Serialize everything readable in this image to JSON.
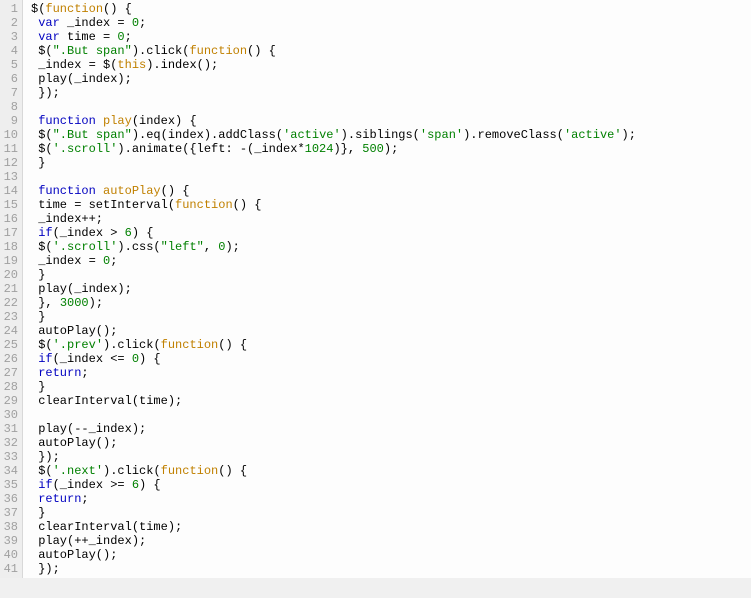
{
  "line_count": 41,
  "code_lines": [
    [
      [
        "punc",
        "$("
      ],
      [
        "fn",
        "function"
      ],
      [
        "punc",
        "() {"
      ]
    ],
    [
      [
        "punc",
        " "
      ],
      [
        "kw",
        "var"
      ],
      [
        "punc",
        " _index = "
      ],
      [
        "num",
        "0"
      ],
      [
        "punc",
        ";"
      ]
    ],
    [
      [
        "punc",
        " "
      ],
      [
        "kw",
        "var"
      ],
      [
        "punc",
        " time = "
      ],
      [
        "num",
        "0"
      ],
      [
        "punc",
        ";"
      ]
    ],
    [
      [
        "punc",
        " $("
      ],
      [
        "str",
        "\".But span\""
      ],
      [
        "punc",
        ").click("
      ],
      [
        "fn",
        "function"
      ],
      [
        "punc",
        "() {"
      ]
    ],
    [
      [
        "punc",
        " _index = $("
      ],
      [
        "this",
        "this"
      ],
      [
        "punc",
        ").index();"
      ]
    ],
    [
      [
        "punc",
        " play(_index);"
      ]
    ],
    [
      [
        "punc",
        " });"
      ]
    ],
    [
      [
        "punc",
        ""
      ]
    ],
    [
      [
        "punc",
        " "
      ],
      [
        "kw",
        "function"
      ],
      [
        "punc",
        " "
      ],
      [
        "fn",
        "play"
      ],
      [
        "punc",
        "(index) {"
      ]
    ],
    [
      [
        "punc",
        " $("
      ],
      [
        "str",
        "\".But span\""
      ],
      [
        "punc",
        ").eq(index).addClass("
      ],
      [
        "str",
        "'active'"
      ],
      [
        "punc",
        ").siblings("
      ],
      [
        "str",
        "'span'"
      ],
      [
        "punc",
        ").removeClass("
      ],
      [
        "str",
        "'active'"
      ],
      [
        "punc",
        ");"
      ]
    ],
    [
      [
        "punc",
        " $("
      ],
      [
        "str",
        "'.scroll'"
      ],
      [
        "punc",
        ").animate({left: -(_index*"
      ],
      [
        "num",
        "1024"
      ],
      [
        "punc",
        ")}, "
      ],
      [
        "num",
        "500"
      ],
      [
        "punc",
        ");"
      ]
    ],
    [
      [
        "punc",
        " }"
      ]
    ],
    [
      [
        "punc",
        ""
      ]
    ],
    [
      [
        "punc",
        " "
      ],
      [
        "kw",
        "function"
      ],
      [
        "punc",
        " "
      ],
      [
        "fn",
        "autoPlay"
      ],
      [
        "punc",
        "() {"
      ]
    ],
    [
      [
        "punc",
        " time = setInterval("
      ],
      [
        "fn",
        "function"
      ],
      [
        "punc",
        "() {"
      ]
    ],
    [
      [
        "punc",
        " _index++;"
      ]
    ],
    [
      [
        "punc",
        " "
      ],
      [
        "kw",
        "if"
      ],
      [
        "punc",
        "(_index > "
      ],
      [
        "num",
        "6"
      ],
      [
        "punc",
        ") {"
      ]
    ],
    [
      [
        "punc",
        " $("
      ],
      [
        "str",
        "'.scroll'"
      ],
      [
        "punc",
        ").css("
      ],
      [
        "str",
        "\"left\""
      ],
      [
        "punc",
        ", "
      ],
      [
        "num",
        "0"
      ],
      [
        "punc",
        ");"
      ]
    ],
    [
      [
        "punc",
        " _index = "
      ],
      [
        "num",
        "0"
      ],
      [
        "punc",
        ";"
      ]
    ],
    [
      [
        "punc",
        " }"
      ]
    ],
    [
      [
        "punc",
        " play(_index);"
      ]
    ],
    [
      [
        "punc",
        " }, "
      ],
      [
        "num",
        "3000"
      ],
      [
        "punc",
        ");"
      ]
    ],
    [
      [
        "punc",
        " }"
      ]
    ],
    [
      [
        "punc",
        " autoPlay();"
      ]
    ],
    [
      [
        "punc",
        " $("
      ],
      [
        "str",
        "'.prev'"
      ],
      [
        "punc",
        ").click("
      ],
      [
        "fn",
        "function"
      ],
      [
        "punc",
        "() {"
      ]
    ],
    [
      [
        "punc",
        " "
      ],
      [
        "kw",
        "if"
      ],
      [
        "punc",
        "(_index <= "
      ],
      [
        "num",
        "0"
      ],
      [
        "punc",
        ") {"
      ]
    ],
    [
      [
        "punc",
        " "
      ],
      [
        "kw",
        "return"
      ],
      [
        "punc",
        ";"
      ]
    ],
    [
      [
        "punc",
        " }"
      ]
    ],
    [
      [
        "punc",
        " clearInterval(time);"
      ]
    ],
    [
      [
        "punc",
        ""
      ]
    ],
    [
      [
        "punc",
        " play(--_index);"
      ]
    ],
    [
      [
        "punc",
        " autoPlay();"
      ]
    ],
    [
      [
        "punc",
        " });"
      ]
    ],
    [
      [
        "punc",
        " $("
      ],
      [
        "str",
        "'.next'"
      ],
      [
        "punc",
        ").click("
      ],
      [
        "fn",
        "function"
      ],
      [
        "punc",
        "() {"
      ]
    ],
    [
      [
        "punc",
        " "
      ],
      [
        "kw",
        "if"
      ],
      [
        "punc",
        "(_index >= "
      ],
      [
        "num",
        "6"
      ],
      [
        "punc",
        ") {"
      ]
    ],
    [
      [
        "punc",
        " "
      ],
      [
        "kw",
        "return"
      ],
      [
        "punc",
        ";"
      ]
    ],
    [
      [
        "punc",
        " }"
      ]
    ],
    [
      [
        "punc",
        " clearInterval(time);"
      ]
    ],
    [
      [
        "punc",
        " play(++_index);"
      ]
    ],
    [
      [
        "punc",
        " autoPlay();"
      ]
    ],
    [
      [
        "punc",
        " });"
      ]
    ]
  ]
}
